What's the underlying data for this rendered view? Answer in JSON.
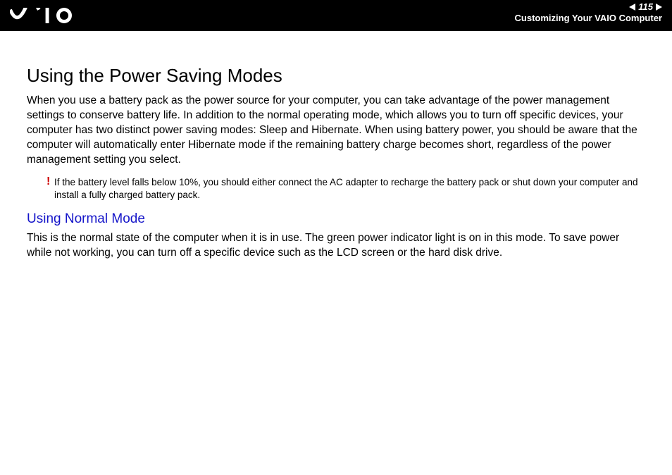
{
  "header": {
    "page_number": "115",
    "section_title": "Customizing Your VAIO Computer"
  },
  "content": {
    "title": "Using the Power Saving Modes",
    "intro": "When you use a battery pack as the power source for your computer, you can take advantage of the power management settings to conserve battery life. In addition to the normal operating mode, which allows you to turn off specific devices, your computer has two distinct power saving modes: Sleep and Hibernate. When using battery power, you should be aware that the computer will automatically enter Hibernate mode if the remaining battery charge becomes short, regardless of the power management setting you select.",
    "note_icon": "!",
    "note": "If the battery level falls below 10%, you should either connect the AC adapter to recharge the battery pack or shut down your computer and install a fully charged battery pack.",
    "subheading": "Using Normal Mode",
    "body": "This is the normal state of the computer when it is in use. The green power indicator light is on in this mode. To save power while not working, you can turn off a specific device such as the LCD screen or the hard disk drive."
  }
}
